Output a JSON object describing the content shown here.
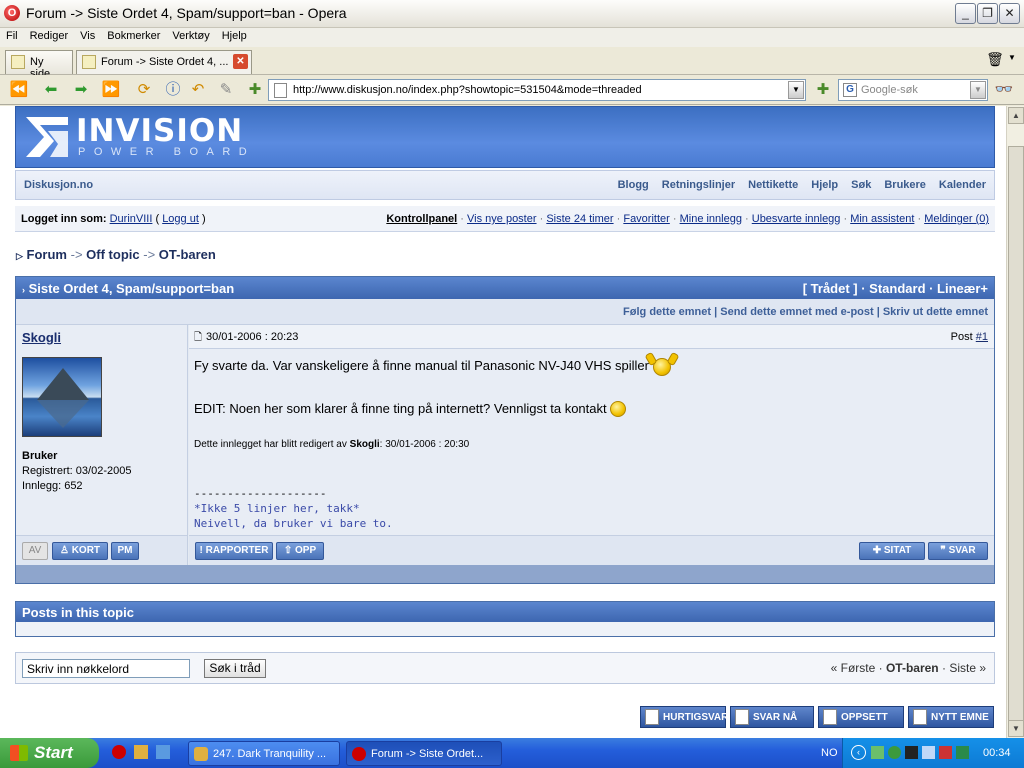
{
  "window": {
    "title": "Forum -> Siste Ordet 4, Spam/support=ban - Opera"
  },
  "menu": [
    "Fil",
    "Rediger",
    "Vis",
    "Bokmerker",
    "Verktøy",
    "Hjelp"
  ],
  "tabs": [
    {
      "label": "Ny side"
    },
    {
      "label": "Forum -> Siste Ordet 4, ..."
    }
  ],
  "toolbar": {
    "url": "http://www.diskusjon.no/index.php?showtopic=531504&mode=threaded",
    "search_placeholder": "Google-søk"
  },
  "banner": {
    "logo": "INVISION",
    "sub": "POWER BOARD"
  },
  "nav": {
    "site": "Diskusjon.no",
    "links": [
      "Blogg",
      "Retningslinjer",
      "Nettikette",
      "Hjelp",
      "Søk",
      "Brukere",
      "Kalender"
    ]
  },
  "userbar": {
    "logged_in_label": "Logget inn som:",
    "user": "DurinVIII",
    "logout": "Logg ut",
    "links": [
      "Kontrollpanel",
      "Vis nye poster",
      "Siste 24 timer",
      "Favoritter",
      "Mine innlegg",
      "Ubesvarte innlegg",
      "Min assistent",
      "Meldinger (0)"
    ]
  },
  "breadcrumb": {
    "items": [
      "Forum",
      "Off topic",
      "OT-baren"
    ],
    "sep": "->"
  },
  "topic": {
    "title": "Siste Ordet 4, Spam/support=ban",
    "modes": "[ Trådet ] · Standard · Lineær+",
    "tools": "Følg dette emnet | Send dette emnet med e-post | Skriv ut dette emnet"
  },
  "post": {
    "author": "Skogli",
    "date": "30/01-2006 : 20:23",
    "post_label": "Post",
    "post_number": "#1",
    "role": "Bruker",
    "registered": "Registrert: 03/02-2005",
    "posts_count": "Innlegg: 652",
    "line1": "Fy svarte da. Var vanskeligere å finne manual til Panasonic NV-J40 VHS spiller",
    "line2": "EDIT: Noen her som klarer å finne ting på internett? Vennligst ta kontakt",
    "edit_note_prefix": "Dette innlegget har blitt redigert av",
    "edit_note_user": "Skogli",
    "edit_note_date": ": 30/01-2006 : 20:30",
    "sig_dash": "--------------------",
    "sig1": "*Ikke 5 linjer her, takk*",
    "sig2": "Neivell, da bruker vi bare to."
  },
  "post_buttons": {
    "av": "AV",
    "kort": "KORT",
    "pm": "PM",
    "rapporter": "RAPPORTER",
    "opp": "OPP",
    "sitat": "SITAT",
    "svar": "SVAR"
  },
  "posts_in_topic": "Posts in this topic",
  "search": {
    "placeholder": "Skriv inn nøkkelord",
    "button": "Søk i tråd"
  },
  "pager": {
    "first": "« Første",
    "current": "OT-baren",
    "last": "Siste »"
  },
  "big_buttons": [
    "HURTIGSVAR",
    "SVAR NÅ",
    "OPPSETT",
    "NYTT EMNE"
  ],
  "taskbar": {
    "start": "Start",
    "items": [
      "247. Dark Tranquility ...",
      "Forum -> Siste Ordet..."
    ],
    "lang": "NO",
    "clock": "00:34"
  }
}
